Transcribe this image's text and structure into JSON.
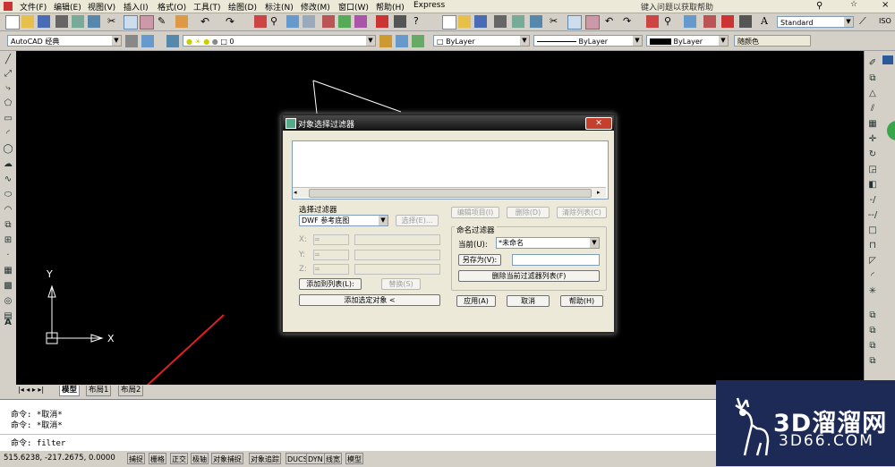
{
  "menu": [
    "文件(F)",
    "编辑(E)",
    "视图(V)",
    "插入(I)",
    "格式(O)",
    "工具(T)",
    "绘图(D)",
    "标注(N)",
    "修改(M)",
    "窗口(W)",
    "帮助(H)",
    "Express"
  ],
  "help_box": "键入问题以获取帮助",
  "toolbar": {
    "workspace": "AutoCAD 经典",
    "layer": "0",
    "text_style": "Standard",
    "color": "ByLayer",
    "linetype": "ByLayer",
    "lineweight": "ByLayer",
    "plotstyle": "随颜色",
    "extra_right": "ISO"
  },
  "dialog": {
    "title": "对象选择过滤器",
    "select_filter_label": "选择过滤器",
    "filter_type": "DWF 参考底图",
    "select_button": "选择(E)...",
    "x_label": "X:",
    "y_label": "Y:",
    "z_label": "Z:",
    "op_value": "=",
    "add_to_list": "添加到列表(L):",
    "replace": "替换(S)",
    "add_selected": "添加选定对象 <",
    "edit_item": "编辑项目(I)",
    "delete": "删除(D)",
    "clear_list": "清除列表(C)",
    "named_filters_label": "命名过滤器",
    "current_label": "当前(U):",
    "current_value": "*未命名",
    "save_as": "另存为(V):",
    "delete_current": "删除当前过滤器列表(F)",
    "apply": "应用(A)",
    "cancel": "取消",
    "help": "帮助(H)"
  },
  "tabs": [
    "模型",
    "布局1",
    "布局2"
  ],
  "command_lines": [
    "命令: *取消*",
    "命令: *取消*",
    "命令: filter"
  ],
  "axis": {
    "x": "X",
    "y": "Y"
  },
  "status": {
    "coords": "515.6238,  -217.2675, 0.0000",
    "buttons": [
      "捕捉",
      "栅格",
      "正交",
      "极轴",
      "对象捕捉",
      "对象追踪",
      "DUCS",
      "DYN",
      "线宽",
      "模型"
    ]
  },
  "watermark": {
    "title": "3D溜溜网",
    "url": "3D66.COM"
  },
  "colors": {
    "accent": "#316ac5",
    "canvas": "#000000",
    "watermark_bg": "#1c2a55"
  }
}
